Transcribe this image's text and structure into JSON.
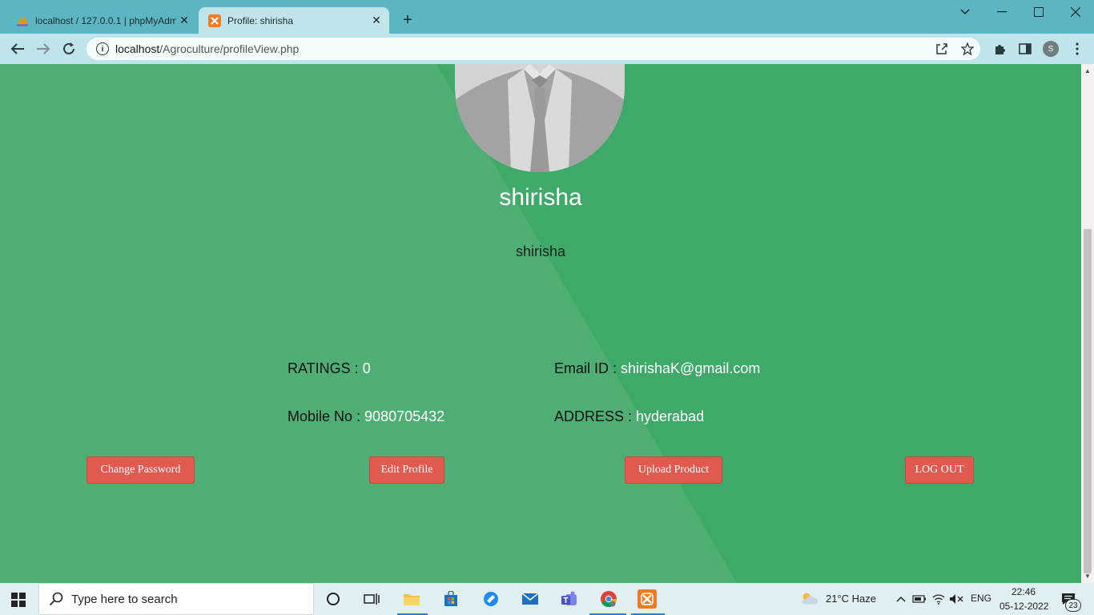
{
  "browser": {
    "tabs": [
      {
        "title": "localhost / 127.0.0.1 | phpMyAdmin",
        "active": false
      },
      {
        "title": "Profile: shirisha",
        "active": true
      }
    ],
    "url_host": "localhost",
    "url_path": "/Agroculture/profileView.php",
    "profile_initial": "S"
  },
  "profile": {
    "name": "shirisha",
    "subname": "shirisha",
    "ratings_label": "RATINGS : ",
    "ratings_value": "0",
    "email_label": "Email ID : ",
    "email_value": "shirishaK@gmail.com",
    "mobile_label": "Mobile No : ",
    "mobile_value": "9080705432",
    "address_label": "ADDRESS : ",
    "address_value": "hyderabad"
  },
  "buttons": {
    "change_password": "Change Password",
    "edit_profile": "Edit Profile",
    "upload_product": "Upload Product",
    "logout": "LOG OUT"
  },
  "taskbar": {
    "search_placeholder": "Type here to search",
    "weather": "21°C  Haze",
    "language": "ENG",
    "time": "22:46",
    "date": "05-12-2022",
    "notification_count": "23"
  },
  "colors": {
    "page_green": "#3ea968",
    "page_green_light": "#4fae73",
    "button_red": "#e05a4f"
  }
}
